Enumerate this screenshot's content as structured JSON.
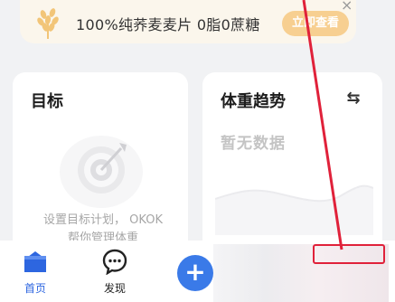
{
  "banner": {
    "text": "100%纯荞麦麦片 0脂0蔗糖",
    "cta": "立即查看",
    "close": "×",
    "icon": "wheat-icon"
  },
  "goal_card": {
    "title": "目标",
    "description_line1": "设置目标计划， OKOK",
    "description_line2": "帮你管理体重",
    "illustration": "target-arrow-icon"
  },
  "weight_card": {
    "title": "体重趋势",
    "empty_text": "暂无数据",
    "switch_icon": "swap-arrows-icon"
  },
  "tabbar": {
    "items": [
      {
        "label": "首页",
        "icon": "home-icon",
        "active": true
      },
      {
        "label": "发现",
        "icon": "chat-bubble-icon",
        "active": false
      }
    ],
    "add_icon": "+",
    "accent_color": "#2d66e0"
  },
  "annotation_color": "#e0213a"
}
